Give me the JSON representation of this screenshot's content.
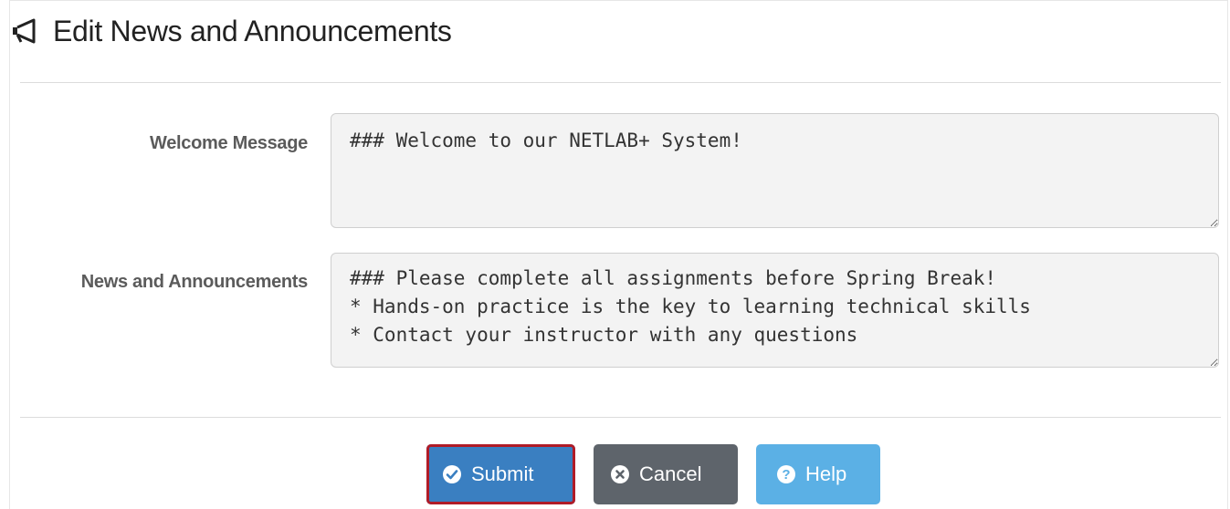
{
  "header": {
    "title": "Edit News and Announcements",
    "icon": "bullhorn-icon"
  },
  "form": {
    "welcome_label": "Welcome Message",
    "welcome_value": "### Welcome to our NETLAB+ System!",
    "news_label": "News and Announcements",
    "news_value": "### Please complete all assignments before Spring Break!\n* Hands-on practice is the key to learning technical skills\n* Contact your instructor with any questions"
  },
  "actions": {
    "submit_label": "Submit",
    "cancel_label": "Cancel",
    "help_label": "Help"
  },
  "colors": {
    "submit": "#3a7fc1",
    "cancel": "#5e646b",
    "help": "#5bb0e5",
    "highlight": "#b01b27"
  }
}
